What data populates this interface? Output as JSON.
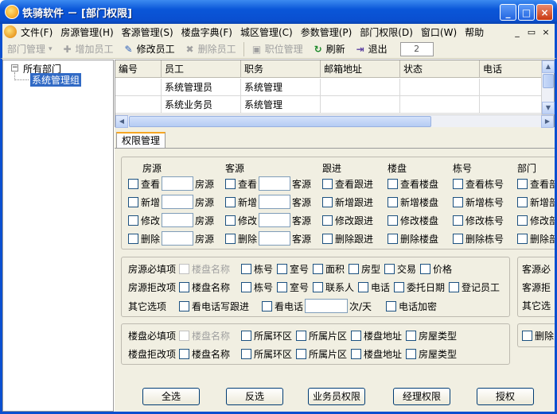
{
  "window": {
    "title": "铁骑软件 － [部门权限]",
    "buttons": [
      "_",
      "□",
      "×"
    ]
  },
  "menu": {
    "items": [
      "文件(F)",
      "房源管理(H)",
      "客源管理(S)",
      "楼盘字典(F)",
      "城区管理(C)",
      "参数管理(P)",
      "部门权限(D)",
      "窗口(W)",
      "帮助"
    ],
    "mdi_buttons": [
      "_",
      "▭",
      "×"
    ]
  },
  "toolbar": {
    "dept": "部门管理",
    "add": "增加员工",
    "edit": "修改员工",
    "delete": "删除员工",
    "position": "职位管理",
    "refresh": "刷新",
    "exit": "退出",
    "page": "2"
  },
  "tree": {
    "root": "所有部门",
    "child": "系统管理组"
  },
  "grid": {
    "headers": [
      "编号",
      "员工",
      "职务",
      "邮箱地址",
      "状态",
      "电话"
    ],
    "rows": [
      [
        "",
        "系统管理员",
        "系统管理",
        "",
        "",
        ""
      ],
      [
        "",
        "系统业务员",
        "系统管理",
        "",
        "",
        ""
      ]
    ]
  },
  "tab": {
    "label": "权限管理"
  },
  "perm": {
    "headers": [
      "房源",
      "客源",
      "跟进",
      "楼盘",
      "栋号",
      "部门"
    ],
    "col1_labels": [
      "查看",
      "新增",
      "修改",
      "删除"
    ],
    "fang": "房源",
    "ke": "客源",
    "genjin": [
      "查看跟进",
      "新增跟进",
      "修改跟进",
      "删除跟进"
    ],
    "loupan": [
      "查看楼盘",
      "新增楼盘",
      "修改楼盘",
      "删除楼盘"
    ],
    "donghao": [
      "查看栋号",
      "新增栋号",
      "修改栋号",
      "删除栋号"
    ],
    "bumen": [
      "查看部",
      "新增部",
      "修改部",
      "删除部"
    ]
  },
  "fang_opts": {
    "required_label": "房源必填项",
    "required": [
      "楼盘名称",
      "栋号",
      "室号",
      "面积",
      "房型",
      "交易",
      "价格"
    ],
    "reject_label": "房源拒改项",
    "reject": [
      "楼盘名称",
      "栋号",
      "室号",
      "联系人",
      "电话",
      "委托日期",
      "登记员工"
    ],
    "other_label": "其它选项",
    "other": [
      "看电话写跟进",
      "看电话",
      "次/天",
      "电话加密"
    ]
  },
  "ke_opts": {
    "required_label": "客源必",
    "reject_label": "客源拒",
    "other_label": "其它选"
  },
  "lp_opts": {
    "required_label": "楼盘必填项",
    "required": [
      "楼盘名称",
      "所属环区",
      "所属片区",
      "楼盘地址",
      "房屋类型"
    ],
    "reject_label": "楼盘拒改项",
    "reject": [
      "楼盘名称",
      "所属环区",
      "所属片区",
      "楼盘地址",
      "房屋类型"
    ],
    "delete_label": "删除"
  },
  "buttons": {
    "select_all": "全选",
    "invert": "反选",
    "staff": "业务员权限",
    "manager": "经理权限",
    "grant": "授权"
  }
}
